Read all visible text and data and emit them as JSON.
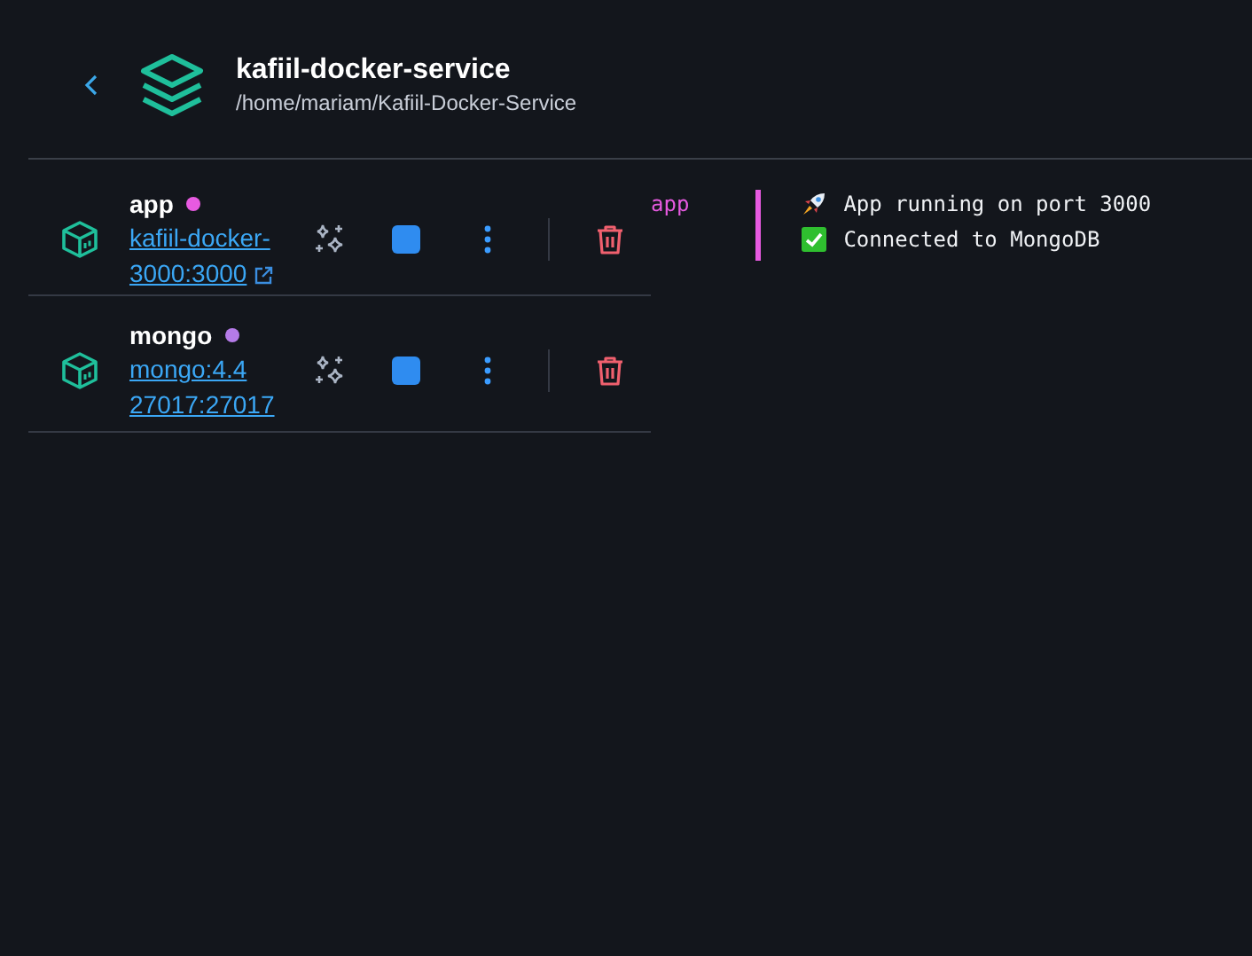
{
  "project": {
    "title": "kafiil-docker-service",
    "path": "/home/mariam/Kafiil-Docker-Service"
  },
  "services": [
    {
      "name": "app",
      "color": "#e75ae0",
      "image": "kafiil-docker-",
      "ports": "3000:3000",
      "external_link": true
    },
    {
      "name": "mongo",
      "color": "#b57be8",
      "image": "mongo:4.4",
      "ports": "27017:27017",
      "external_link": false
    }
  ],
  "logs": {
    "source": "app",
    "lines": [
      {
        "kind": "rocket",
        "text": "App running on port 3000"
      },
      {
        "kind": "check",
        "text": "Connected to MongoDB"
      }
    ]
  }
}
